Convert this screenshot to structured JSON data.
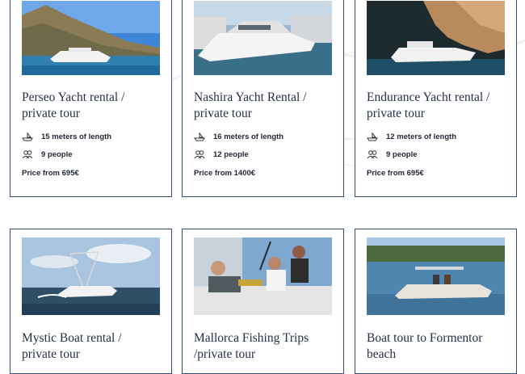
{
  "cards": [
    {
      "title": "Perseo Yacht rental / private tour",
      "length": "15 meters of length",
      "people": "9 people",
      "price": "Price from 695€"
    },
    {
      "title": "Nashira Yacht Rental / private tour",
      "length": "16 meters of length",
      "people": "12 people",
      "price": "Price from 1400€"
    },
    {
      "title": "Endurance Yacht rental / private tour",
      "length": "12 meters of length",
      "people": "9 people",
      "price": "Price from 695€"
    },
    {
      "title": "Mystic Boat rental / private tour"
    },
    {
      "title": "Mallorca Fishing Trips /private tour"
    },
    {
      "title": "Boat tour to Formentor beach"
    }
  ],
  "icons": {
    "length": "boat-icon",
    "people": "people-icon"
  },
  "colors": {
    "border": "#33497a",
    "text": "#252f45"
  }
}
